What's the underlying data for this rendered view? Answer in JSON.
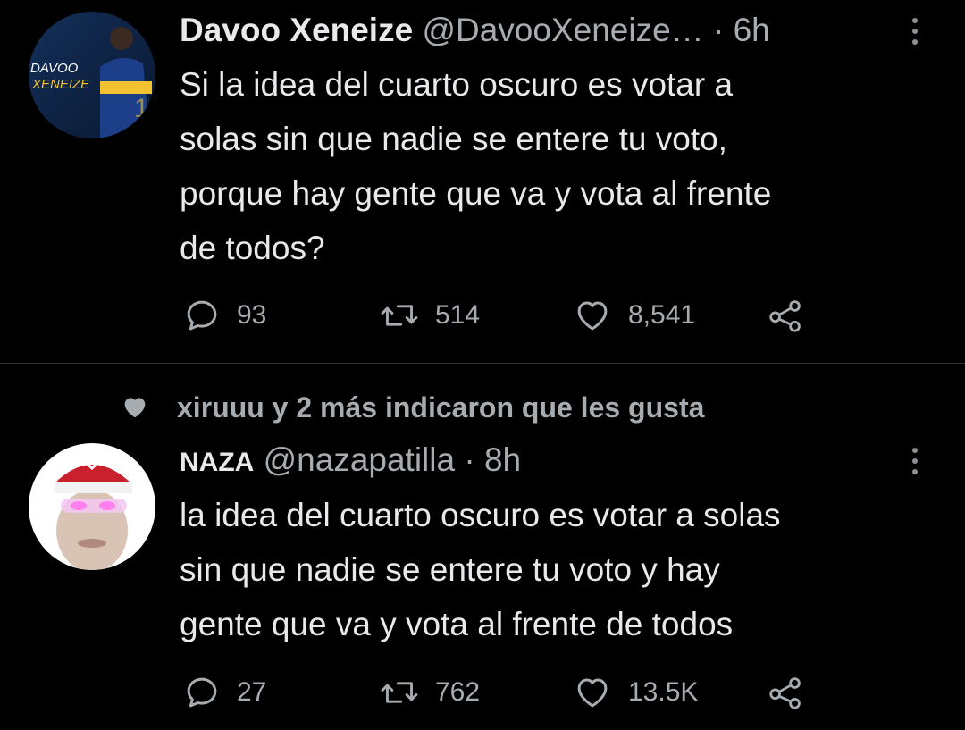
{
  "tweets": [
    {
      "avatar_text": [
        "DAVOO",
        "XENEIZE"
      ],
      "display_name": "Davoo Xeneize",
      "handle": "@DavooXeneize…",
      "time": "6h",
      "dot": "·",
      "text_lines": [
        "Si la idea del cuarto oscuro es votar a",
        "solas sin que nadie se entere tu voto,",
        "porque hay gente que va y vota al frente",
        "de todos?"
      ],
      "replies": "93",
      "retweets": "514",
      "likes": "8,541"
    },
    {
      "social_context": "xiruuu y 2 más indicaron que les gusta",
      "display_name": "NAZA",
      "handle": "@nazapatilla",
      "time": "8h",
      "dot": "·",
      "text_lines": [
        "la idea del cuarto oscuro es votar a solas",
        "sin que nadie se entere tu voto y hay",
        "gente que va y vota al frente de todos"
      ],
      "replies": "27",
      "retweets": "762",
      "likes": "13.5K"
    }
  ],
  "icons": {
    "reply": "reply-icon",
    "retweet": "retweet-icon",
    "like": "heart-icon",
    "share": "share-icon",
    "more": "more-icon",
    "social_like": "heart-filled-icon"
  },
  "colors": {
    "background": "#000000",
    "text": "#e7e9ea",
    "secondary": "#a7acb1",
    "divider": "#2f3336"
  }
}
